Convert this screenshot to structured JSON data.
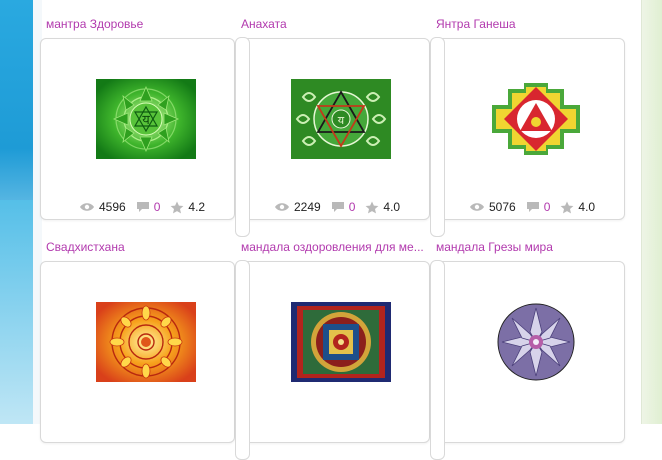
{
  "items": [
    {
      "title": "мантра Здоровье",
      "views": "4596",
      "comments": "0",
      "rating": "4.2"
    },
    {
      "title": "Анахата",
      "views": "2249",
      "comments": "0",
      "rating": "4.0"
    },
    {
      "title": "Янтра Ганеша",
      "views": "5076",
      "comments": "0",
      "rating": "4.0"
    },
    {
      "title": "Свадхистхана",
      "views": "",
      "comments": "",
      "rating": ""
    },
    {
      "title": "мандала оздоровления для ме...",
      "views": "",
      "comments": "",
      "rating": ""
    },
    {
      "title": "мандала Грезы мира",
      "views": "",
      "comments": "",
      "rating": ""
    }
  ],
  "icons": {
    "views": "eye-icon",
    "comments": "comment-icon",
    "rating": "star-icon"
  },
  "colors": {
    "title_link": "#b23aae",
    "comment_count": "#b23aae",
    "card_border": "#d9d9d9",
    "icon_gray": "#b9b9b9"
  }
}
